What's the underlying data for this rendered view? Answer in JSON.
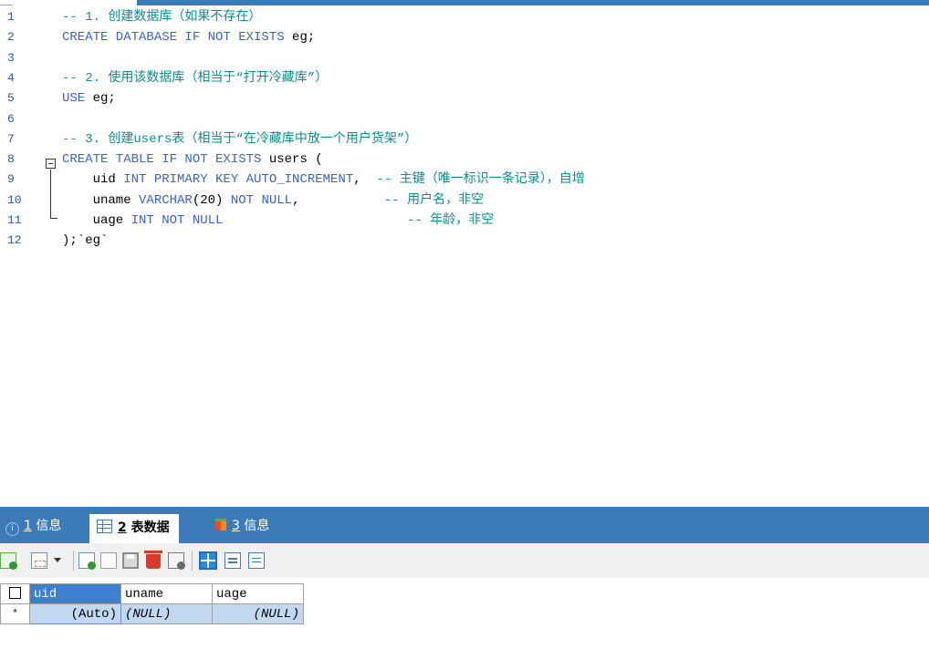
{
  "editor": {
    "lines": [
      {
        "num": "1",
        "parts": [
          {
            "t": "-- 1. 创建数据库（如果不存在）",
            "c": "cm"
          }
        ]
      },
      {
        "num": "2",
        "parts": [
          {
            "t": "CREATE DATABASE IF NOT EXISTS ",
            "c": "kw"
          },
          {
            "t": "eg;",
            "c": "id"
          }
        ]
      },
      {
        "num": "3",
        "parts": []
      },
      {
        "num": "4",
        "parts": [
          {
            "t": "-- 2. 使用该数据库（相当于“打开冷藏库”）",
            "c": "cm"
          }
        ]
      },
      {
        "num": "5",
        "parts": [
          {
            "t": "USE ",
            "c": "kw"
          },
          {
            "t": "eg;",
            "c": "id"
          }
        ]
      },
      {
        "num": "6",
        "parts": []
      },
      {
        "num": "7",
        "parts": [
          {
            "t": "-- 3. 创建users表（相当于“在冷藏库中放一个用户货架”）",
            "c": "cm"
          }
        ]
      },
      {
        "num": "8",
        "parts": [
          {
            "t": "CREATE TABLE IF NOT EXISTS ",
            "c": "kw"
          },
          {
            "t": "users (",
            "c": "id"
          }
        ]
      },
      {
        "num": "9",
        "parts": [
          {
            "t": "    uid ",
            "c": "id"
          },
          {
            "t": "INT PRIMARY KEY AUTO_INCREMENT",
            "c": "kw"
          },
          {
            "t": ",  ",
            "c": "id"
          },
          {
            "t": "-- 主键（唯一标识一条记录），自增",
            "c": "cm"
          }
        ]
      },
      {
        "num": "10",
        "parts": [
          {
            "t": "    uname ",
            "c": "id"
          },
          {
            "t": "VARCHAR",
            "c": "kw"
          },
          {
            "t": "(20) ",
            "c": "id"
          },
          {
            "t": "NOT NULL",
            "c": "kw"
          },
          {
            "t": ",           ",
            "c": "id"
          },
          {
            "t": "-- 用户名，非空",
            "c": "cm"
          }
        ]
      },
      {
        "num": "11",
        "parts": [
          {
            "t": "    uage ",
            "c": "id"
          },
          {
            "t": "INT NOT NULL",
            "c": "kw"
          },
          {
            "t": "                        ",
            "c": "id"
          },
          {
            "t": "-- 年龄，非空",
            "c": "cm"
          }
        ]
      },
      {
        "num": "12",
        "parts": [
          {
            "t": ");`eg`",
            "c": "id"
          }
        ]
      }
    ]
  },
  "panel": {
    "tabs": [
      {
        "num": "1",
        "label": "信息",
        "icon": "info-icon"
      },
      {
        "num": "2",
        "label": "表数据",
        "icon": "table-grid-icon",
        "active": true
      },
      {
        "num": "3",
        "label": "信息",
        "icon": "cube-icon"
      }
    ],
    "toolbar_icons": [
      "add-row-icon",
      "insert-row-dropdown-icon",
      "duplicate-row-icon",
      "copy-row-icon",
      "save-icon",
      "delete-icon",
      "cancel-icon",
      "grid-view-icon",
      "form-view-icon",
      "text-view-icon"
    ],
    "grid": {
      "headers": [
        "uid",
        "uname",
        "uage"
      ],
      "rows": [
        {
          "marker": "*",
          "uid": "(Auto)",
          "uname": "(NULL)",
          "uage": "(NULL)"
        }
      ]
    }
  },
  "colors": {
    "accent": "#3d7ab8",
    "keyword": "#3c63c4",
    "comment": "#0a8f8f",
    "selection": "#c2d8f0"
  }
}
